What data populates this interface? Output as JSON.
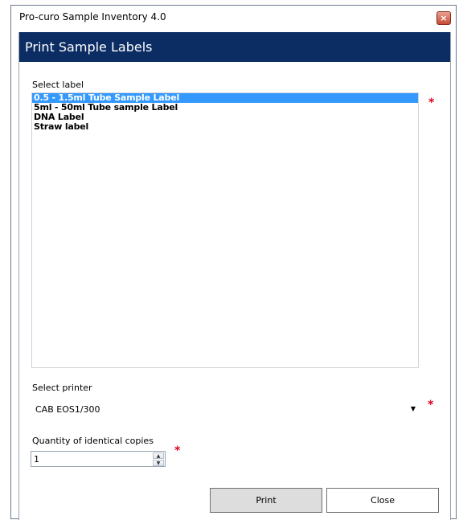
{
  "window": {
    "title": "Pro-curo Sample Inventory 4.0",
    "close_glyph": "×"
  },
  "dialog": {
    "heading": "Print Sample Labels"
  },
  "label_section": {
    "title": "Select label",
    "required_mark": "*",
    "items": [
      {
        "label": "0.5 - 1.5ml Tube Sample Label",
        "selected": true
      },
      {
        "label": "5ml - 50ml Tube sample Label",
        "selected": false
      },
      {
        "label": "DNA Label",
        "selected": false
      },
      {
        "label": "Straw label",
        "selected": false
      }
    ]
  },
  "printer_section": {
    "title": "Select printer",
    "value": "CAB EOS1/300",
    "arrow": "▼",
    "required_mark": "*"
  },
  "copies_section": {
    "title": "Quantity of identical copies",
    "value": "1",
    "up": "▲",
    "down": "▼",
    "required_mark": "*"
  },
  "buttons": {
    "print": "Print",
    "close": "Close"
  },
  "colors": {
    "header_bg": "#0b2d63",
    "selection": "#3399ff",
    "required": "#e0001a"
  }
}
